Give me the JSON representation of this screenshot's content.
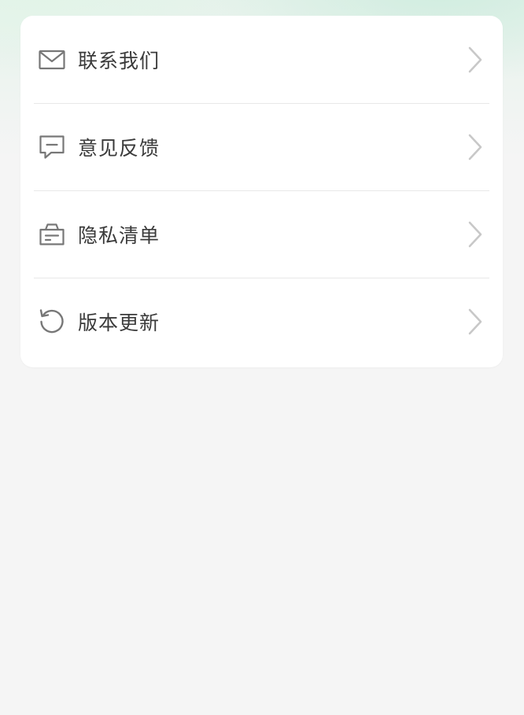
{
  "colors": {
    "background": "#f5f5f5",
    "card": "#ffffff",
    "text": "#3a3a3a",
    "icon": "#777777",
    "chevron": "#c8c8c8",
    "divider": "#e8e8e8"
  },
  "menu": {
    "items": [
      {
        "label": "联系我们",
        "icon": "mail-icon"
      },
      {
        "label": "意见反馈",
        "icon": "feedback-icon"
      },
      {
        "label": "隐私清单",
        "icon": "privacy-list-icon"
      },
      {
        "label": "版本更新",
        "icon": "refresh-icon"
      }
    ]
  }
}
